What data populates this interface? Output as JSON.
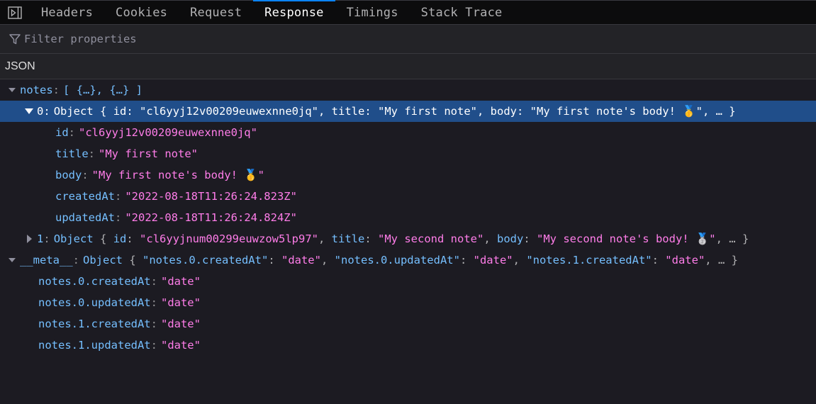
{
  "tabs": {
    "toggle_icon": "sidebar-toggle-icon",
    "items": [
      {
        "label": "Headers"
      },
      {
        "label": "Cookies"
      },
      {
        "label": "Request"
      },
      {
        "label": "Response",
        "selected": true
      },
      {
        "label": "Timings"
      },
      {
        "label": "Stack Trace"
      }
    ]
  },
  "filter": {
    "placeholder": "Filter properties",
    "value": ""
  },
  "section_label": "JSON",
  "tree": {
    "notes": {
      "key": "notes",
      "preview_open": "[ ",
      "preview_items": "{…}, {…}",
      "preview_close": " ]",
      "expanded": true
    },
    "note0": {
      "key": "0",
      "type": "Object",
      "expanded": true,
      "selected": true,
      "preview": [
        {
          "k": "id",
          "v": "\"cl6yyj12v00209euwexnne0jq\""
        },
        {
          "k": "title",
          "v": "\"My first note\""
        },
        {
          "k": "body",
          "v": "\"My first note's body! 🥇\""
        }
      ],
      "ellipsis": "…",
      "children": [
        {
          "k": "id",
          "v": "\"cl6yyj12v00209euwexnne0jq\""
        },
        {
          "k": "title",
          "v": "\"My first note\""
        },
        {
          "k": "body",
          "v": "\"My first note's body! 🥇\""
        },
        {
          "k": "createdAt",
          "v": "\"2022-08-18T11:26:24.823Z\""
        },
        {
          "k": "updatedAt",
          "v": "\"2022-08-18T11:26:24.824Z\""
        }
      ]
    },
    "note1": {
      "key": "1",
      "type": "Object",
      "expanded": false,
      "preview": [
        {
          "k": "id",
          "v": "\"cl6yyjnum00299euwzow5lp97\""
        },
        {
          "k": "title",
          "v": "\"My second note\""
        },
        {
          "k": "body",
          "v": "\"My second note's body! 🥈\""
        }
      ],
      "ellipsis": "…"
    },
    "meta": {
      "key": "__meta__",
      "type": "Object",
      "expanded": true,
      "preview": [
        {
          "k": "\"notes.0.createdAt\"",
          "v": "\"date\""
        },
        {
          "k": "\"notes.0.updatedAt\"",
          "v": "\"date\""
        },
        {
          "k": "\"notes.1.createdAt\"",
          "v": "\"date\""
        }
      ],
      "ellipsis": "…",
      "children": [
        {
          "k": "notes.0.createdAt",
          "v": "\"date\""
        },
        {
          "k": "notes.0.updatedAt",
          "v": "\"date\""
        },
        {
          "k": "notes.1.createdAt",
          "v": "\"date\""
        },
        {
          "k": "notes.1.updatedAt",
          "v": "\"date\""
        }
      ]
    }
  },
  "colors": {
    "accent": "#0a84ff",
    "selection": "#204e8a",
    "key": "#75bfff",
    "string": "#ff7de9"
  }
}
